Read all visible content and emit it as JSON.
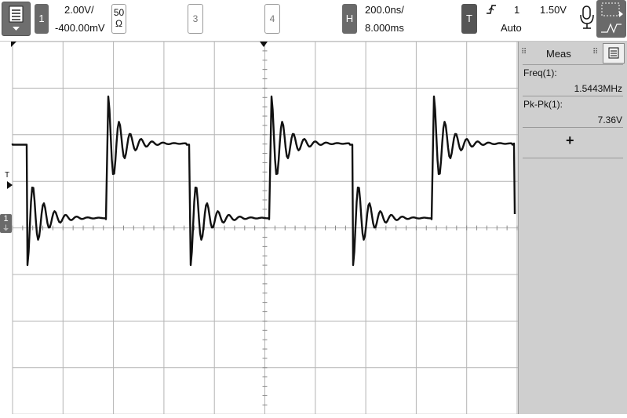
{
  "toolbar": {
    "menu_icon": "menu-list-icon",
    "channel1": {
      "number": "1",
      "scale": "2.00V/",
      "offset": "-400.00mV",
      "impedance_top": "50",
      "impedance_bottom": "Ω"
    },
    "channel3": {
      "number": "3"
    },
    "channel4": {
      "number": "4"
    },
    "horizontal": {
      "label": "H",
      "timebase": "200.0ns/",
      "delay": "8.000ms"
    },
    "trigger": {
      "label": "T",
      "edge_icon": "rising-edge-icon",
      "source": "1",
      "level": "1.50V",
      "mode": "Auto"
    },
    "voice_icon": "microphone-icon",
    "tool_icons": [
      "zoom-box-icon",
      "waveform-tool-icon"
    ]
  },
  "measurements": {
    "title": "Meas",
    "menu_icon": "panel-menu-icon",
    "items": [
      {
        "label": "Freq(1):",
        "value": "1.5443MHz"
      },
      {
        "label": "Pk-Pk(1):",
        "value": "7.36V"
      }
    ],
    "add_label": "+"
  },
  "markers": {
    "trigger_level": "T",
    "channel1_ground": "1"
  },
  "colors": {
    "trace": "#111111",
    "grid": "#b4b4b4",
    "panel": "#cfcfcf",
    "chip": "#6a6a6a"
  }
}
